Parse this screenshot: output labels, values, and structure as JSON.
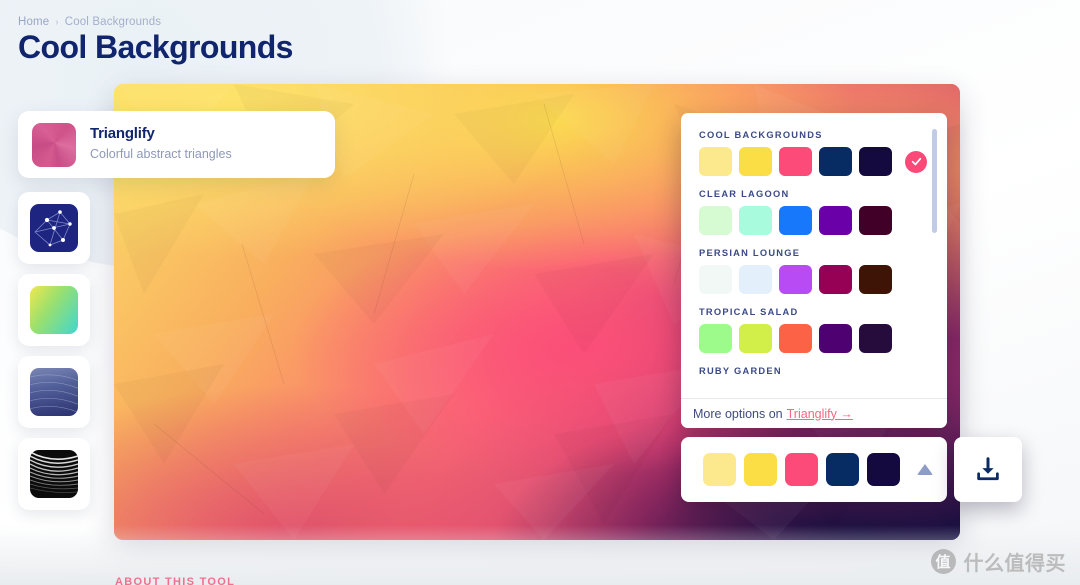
{
  "breadcrumb": {
    "home": "Home",
    "separator": "›",
    "current": "Cool Backgrounds"
  },
  "header": {
    "title": "Cool Backgrounds"
  },
  "tool_card": {
    "name": "Trianglify",
    "description": "Colorful abstract triangles",
    "thumb_icon": "trianglify-thumbnail"
  },
  "sidebar": {
    "items": [
      {
        "name": "low-poly",
        "icon": "low-poly-thumbnail"
      },
      {
        "name": "gradient",
        "icon": "gradient-thumbnail"
      },
      {
        "name": "waves",
        "icon": "waves-thumbnail"
      },
      {
        "name": "moire",
        "icon": "moire-thumbnail"
      }
    ]
  },
  "palette_panel": {
    "groups": [
      {
        "label": "COOL BACKGROUNDS",
        "selected": true,
        "colors": [
          "#FCE98E",
          "#FBDD46",
          "#FD4B79",
          "#072C63",
          "#140A40"
        ]
      },
      {
        "label": "CLEAR LAGOON",
        "selected": false,
        "colors": [
          "#D6FAD1",
          "#A8FBDD",
          "#1878FC",
          "#6A00A8",
          "#400028"
        ]
      },
      {
        "label": "PERSIAN LOUNGE",
        "selected": false,
        "colors": [
          "#F1F8F6",
          "#E3F0FC",
          "#B94BF5",
          "#960055",
          "#3D1405"
        ]
      },
      {
        "label": "TROPICAL SALAD",
        "selected": false,
        "colors": [
          "#9DFB8C",
          "#D2EE48",
          "#FC6246",
          "#4E0271",
          "#260B3D"
        ]
      },
      {
        "label": "RUBY GARDEN",
        "selected": false,
        "colors": []
      }
    ],
    "footer": {
      "text": "More options on",
      "link": "Trianglify →"
    },
    "check_icon": "check-icon",
    "accent": "#FB4A77"
  },
  "bottom_bar": {
    "colors": [
      "#FCE98E",
      "#FBDD46",
      "#FD4B79",
      "#072C63",
      "#140A40"
    ],
    "expand_icon": "caret-up-icon",
    "download_icon": "download-icon"
  },
  "about": {
    "label": "ABOUT THIS TOOL"
  },
  "watermark": {
    "badge": "值",
    "text": "什么值得买"
  },
  "colors": {
    "title": "#10256E",
    "breadcrumb": "#9AA6C4",
    "accent_pink": "#FB4A77",
    "link_pink": "#F7677F",
    "palette_label": "#3A4A86"
  }
}
